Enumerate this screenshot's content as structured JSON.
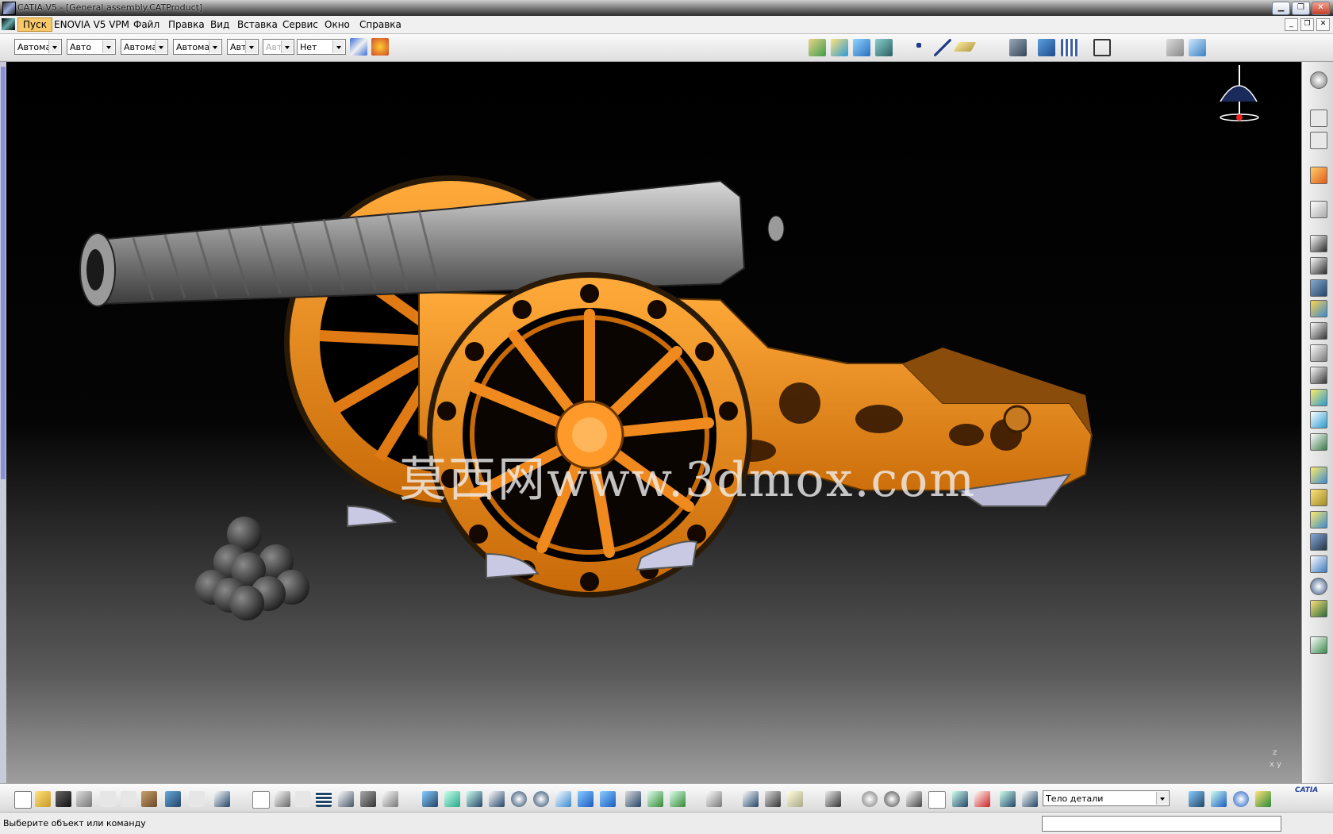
{
  "window": {
    "title": "CATIA V5 - [General assembly.CATProduct]"
  },
  "menu": {
    "items": [
      "Пуск",
      "ENOVIA V5 VPM",
      "Файл",
      "Правка",
      "Вид",
      "Вставка",
      "Сервис",
      "Окно",
      "Справка"
    ]
  },
  "toolbar_top": {
    "combos": [
      "Автома",
      "Авто",
      "Автома",
      "Автома",
      "Авт",
      "Авт",
      "Нет"
    ]
  },
  "viewport": {
    "watermark": "莫西网www.3dmox.com",
    "axis_z": "z",
    "axis_xy": "x  y"
  },
  "toolbar_bottom": {
    "body_combo": "Тело детали",
    "logo": "CATIA"
  },
  "status": {
    "prompt": "Выберите объект или команду"
  }
}
